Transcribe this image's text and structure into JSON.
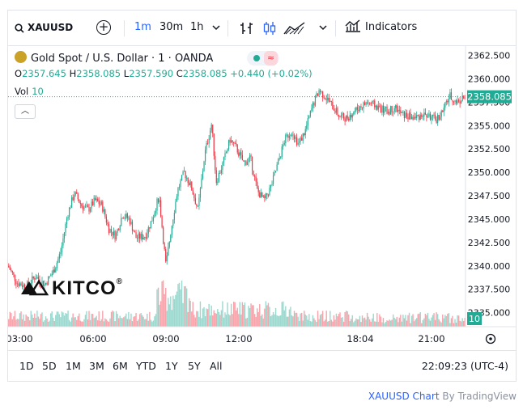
{
  "toolbar": {
    "symbol": "XAUUSD",
    "intervals": [
      "1m",
      "30m",
      "1h"
    ],
    "active_interval": "1m",
    "indicators_label": "Indicators"
  },
  "legend": {
    "title": "Gold Spot / U.S. Dollar · 1 · OANDA",
    "ohlc": {
      "o": "2357.645",
      "h": "2358.085",
      "l": "2357.590",
      "c": "2358.085",
      "change": "+0.440 (+0.02%)"
    },
    "vol_label": "Vol",
    "vol_value": "10"
  },
  "watermark": "KITCO",
  "chart_data": {
    "type": "candlestick",
    "y_ticks": [
      "2362.500",
      "2360.000",
      "2357.500",
      "2355.000",
      "2352.500",
      "2350.000",
      "2347.500",
      "2345.000",
      "2342.500",
      "2340.000",
      "2337.500",
      "2335.000"
    ],
    "x_ticks": [
      "03:00",
      "06:00",
      "09:00",
      "12:00",
      "18:04",
      "21:00"
    ],
    "last_price": "2358.085",
    "last_volume": "10",
    "ylim": [
      2333.5,
      2363.5
    ],
    "approx_path": [
      [
        0,
        2340.0
      ],
      [
        0.02,
        2338.2
      ],
      [
        0.04,
        2337.8
      ],
      [
        0.06,
        2338.9
      ],
      [
        0.08,
        2338.0
      ],
      [
        0.1,
        2339.5
      ],
      [
        0.115,
        2341.5
      ],
      [
        0.13,
        2345.5
      ],
      [
        0.145,
        2347.8
      ],
      [
        0.16,
        2346.5
      ],
      [
        0.175,
        2346.0
      ],
      [
        0.19,
        2347.0
      ],
      [
        0.205,
        2346.5
      ],
      [
        0.22,
        2344.0
      ],
      [
        0.235,
        2343.2
      ],
      [
        0.25,
        2345.5
      ],
      [
        0.265,
        2345.0
      ],
      [
        0.28,
        2343.0
      ],
      [
        0.3,
        2343.2
      ],
      [
        0.315,
        2345.0
      ],
      [
        0.33,
        2347.5
      ],
      [
        0.345,
        2340.0
      ],
      [
        0.355,
        2343.5
      ],
      [
        0.37,
        2348.0
      ],
      [
        0.385,
        2350.0
      ],
      [
        0.4,
        2348.5
      ],
      [
        0.415,
        2346.0
      ],
      [
        0.43,
        2352.0
      ],
      [
        0.445,
        2355.2
      ],
      [
        0.455,
        2349.0
      ],
      [
        0.47,
        2351.0
      ],
      [
        0.485,
        2353.5
      ],
      [
        0.5,
        2352.5
      ],
      [
        0.515,
        2351.0
      ],
      [
        0.53,
        2351.5
      ],
      [
        0.545,
        2348.0
      ],
      [
        0.56,
        2347.0
      ],
      [
        0.575,
        2348.5
      ],
      [
        0.59,
        2351.0
      ],
      [
        0.605,
        2353.5
      ],
      [
        0.62,
        2354.5
      ],
      [
        0.635,
        2353.0
      ],
      [
        0.65,
        2354.5
      ],
      [
        0.665,
        2357.0
      ],
      [
        0.68,
        2358.8
      ],
      [
        0.695,
        2358.0
      ],
      [
        0.71,
        2357.0
      ],
      [
        0.725,
        2356.0
      ],
      [
        0.74,
        2355.8
      ],
      [
        0.755,
        2356.5
      ],
      [
        0.77,
        2357.0
      ],
      [
        0.785,
        2357.5
      ],
      [
        0.8,
        2357.2
      ],
      [
        0.815,
        2356.8
      ],
      [
        0.83,
        2356.5
      ],
      [
        0.845,
        2357.0
      ],
      [
        0.86,
        2356.2
      ],
      [
        0.875,
        2356.0
      ],
      [
        0.89,
        2355.8
      ],
      [
        0.905,
        2356.2
      ],
      [
        0.92,
        2356.0
      ],
      [
        0.935,
        2355.6
      ],
      [
        0.95,
        2356.5
      ],
      [
        0.965,
        2358.2
      ],
      [
        0.98,
        2357.5
      ],
      [
        1.0,
        2358.085
      ]
    ]
  },
  "range_buttons": [
    "1D",
    "5D",
    "1M",
    "3M",
    "6M",
    "YTD",
    "1Y",
    "5Y",
    "All"
  ],
  "clock": "22:09:23 (UTC-4)",
  "attribution": {
    "symbol_text": "XAUUSD Chart",
    "by_text": " By TradingView"
  },
  "colors": {
    "up": "#22ab94",
    "down": "#f23645",
    "accent": "#2962ff"
  }
}
